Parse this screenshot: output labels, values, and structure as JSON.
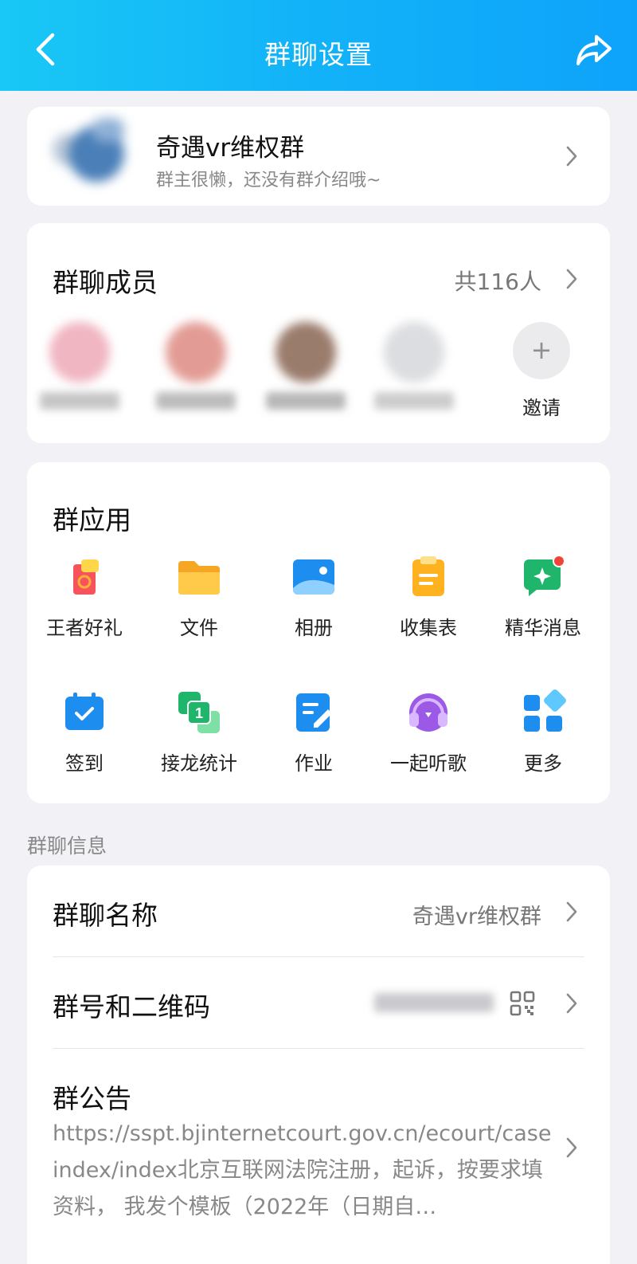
{
  "header": {
    "title": "群聊设置",
    "accent": "#12b2f8"
  },
  "group": {
    "name": "奇遇vr维权群",
    "description": "群主很懒，还没有群介绍哦~"
  },
  "members": {
    "label": "群聊成员",
    "count": "共116人",
    "avatars": [
      {
        "color": "#f0b6c2",
        "name_color": "#c6c6c6"
      },
      {
        "color": "#e39c95",
        "name_color": "#bcbcbc"
      },
      {
        "color": "#9a7c6c",
        "name_color": "#b7b7b7"
      },
      {
        "color": "#dcdde0",
        "name_color": "#cdcdcd"
      }
    ],
    "invite_label": "邀请"
  },
  "apps": {
    "label": "群应用",
    "items": [
      {
        "label": "王者好礼",
        "icon": "gift-icon"
      },
      {
        "label": "文件",
        "icon": "folder-icon"
      },
      {
        "label": "相册",
        "icon": "album-icon"
      },
      {
        "label": "收集表",
        "icon": "clipboard-icon"
      },
      {
        "label": "精华消息",
        "icon": "sparkle-message-icon"
      },
      {
        "label": "签到",
        "icon": "calendar-check-icon"
      },
      {
        "label": "接龙统计",
        "icon": "chain-count-icon"
      },
      {
        "label": "作业",
        "icon": "homework-icon"
      },
      {
        "label": "一起听歌",
        "icon": "headphone-music-icon"
      },
      {
        "label": "更多",
        "icon": "more-grid-icon"
      }
    ]
  },
  "info": {
    "section_label": "群聊信息",
    "name_label": "群聊名称",
    "name_value": "奇遇vr维权群",
    "qrcode_label": "群号和二维码",
    "notice_label": "群公告",
    "notice_text": "https://sspt.bjinternetcourt.gov.cn/ecourt/caseindex/index北京互联网法院注册，起诉，按要求填资料， 我发个模板（2022年（日期自…"
  }
}
